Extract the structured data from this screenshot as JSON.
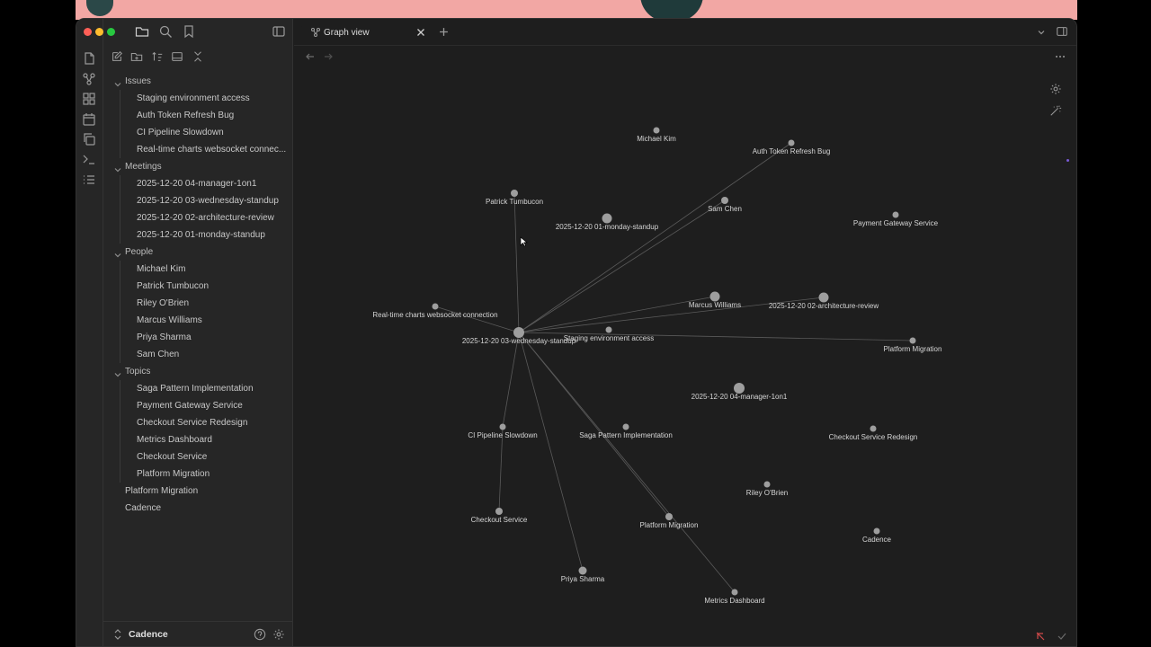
{
  "tab": {
    "title": "Graph view"
  },
  "vault": {
    "name": "Cadence"
  },
  "tree": {
    "issues": {
      "label": "Issues",
      "items": [
        "Staging environment access",
        "Auth Token Refresh Bug",
        "CI Pipeline Slowdown",
        "Real-time charts websocket connec..."
      ]
    },
    "meetings": {
      "label": "Meetings",
      "items": [
        "2025-12-20 04-manager-1on1",
        "2025-12-20 03-wednesday-standup",
        "2025-12-20 02-architecture-review",
        "2025-12-20 01-monday-standup"
      ]
    },
    "people": {
      "label": "People",
      "items": [
        "Michael Kim",
        "Patrick Tumbucon",
        "Riley O'Brien",
        "Marcus Williams",
        "Priya Sharma",
        "Sam Chen"
      ]
    },
    "topics": {
      "label": "Topics",
      "items": [
        "Saga Pattern Implementation",
        "Payment Gateway Service",
        "Checkout Service Redesign",
        "Metrics Dashboard",
        "Checkout Service",
        "Platform Migration"
      ]
    },
    "root_files": [
      "Platform Migration",
      "Cadence"
    ]
  },
  "graph": {
    "nodes": [
      {
        "label": "Michael Kim"
      },
      {
        "label": "Auth Token Refresh Bug"
      },
      {
        "label": "Patrick Tumbucon"
      },
      {
        "label": "Sam Chen"
      },
      {
        "label": "2025-12-20 01-monday-standup"
      },
      {
        "label": "Payment Gateway Service"
      },
      {
        "label": "Marcus Williams"
      },
      {
        "label": "2025-12-20 02-architecture-review"
      },
      {
        "label": "Real-time charts websocket connection"
      },
      {
        "label": "2025-12-20 03-wednesday-standup"
      },
      {
        "label": "Staging environment access"
      },
      {
        "label": "Platform Migration"
      },
      {
        "label": "2025-12-20 04-manager-1on1"
      },
      {
        "label": "CI Pipeline Slowdown"
      },
      {
        "label": "Saga Pattern Implementation"
      },
      {
        "label": "Checkout Service Redesign"
      },
      {
        "label": "Riley O'Brien"
      },
      {
        "label": "Checkout Service"
      },
      {
        "label": "Platform Migration"
      },
      {
        "label": "Cadence"
      },
      {
        "label": "Priya Sharma"
      },
      {
        "label": "Metrics Dashboard"
      }
    ],
    "edges": [
      [
        "2025-12-20 03-wednesday-standup",
        "Auth Token Refresh Bug"
      ],
      [
        "2025-12-20 03-wednesday-standup",
        "Sam Chen"
      ],
      [
        "2025-12-20 03-wednesday-standup",
        "Patrick Tumbucon"
      ],
      [
        "2025-12-20 03-wednesday-standup",
        "Marcus Williams"
      ],
      [
        "2025-12-20 03-wednesday-standup",
        "Real-time charts websocket connection"
      ],
      [
        "2025-12-20 03-wednesday-standup",
        "Platform Migration"
      ],
      [
        "2025-12-20 03-wednesday-standup",
        "CI Pipeline Slowdown"
      ],
      [
        "2025-12-20 03-wednesday-standup",
        "Priya Sharma"
      ],
      [
        "2025-12-20 03-wednesday-standup",
        "Metrics Dashboard"
      ],
      [
        "2025-12-20 03-wednesday-standup",
        "Platform Migration (topic)"
      ],
      [
        "CI Pipeline Slowdown",
        "Checkout Service"
      ]
    ]
  }
}
